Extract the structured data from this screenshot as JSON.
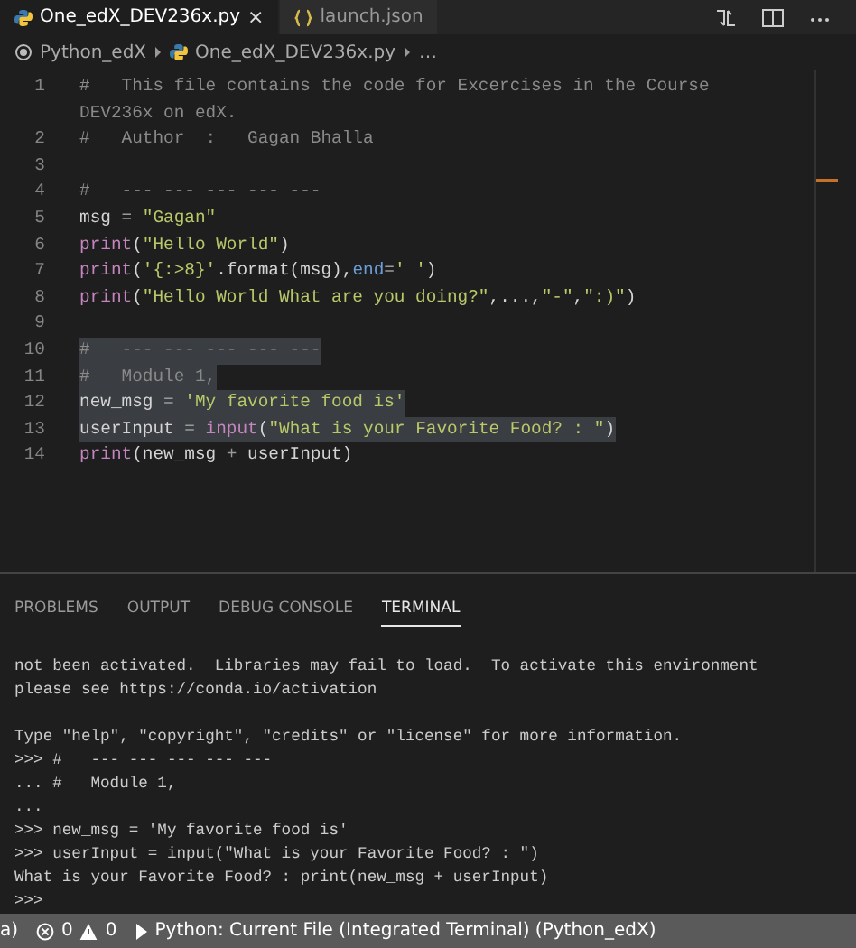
{
  "editor_tabs": [
    {
      "label": "One_edX_DEV236x.py",
      "kind": "python",
      "close": "×",
      "selected": true
    },
    {
      "label": "launch.json",
      "kind": "json",
      "selected": false
    }
  ],
  "breadcrumb": [
    "Python_edX",
    "One_edX_DEV236x.py",
    "…"
  ],
  "code_lines": [
    {
      "number": "1",
      "selected": false,
      "tokens": [
        {
          "kind": "comment",
          "text": "#   This file contains the code for Excercises in the Course DEV236x on edX."
        }
      ]
    },
    {
      "number": "2",
      "selected": false,
      "tokens": [
        {
          "kind": "comment",
          "text": "#   Author  :   Gagan Bhalla"
        }
      ]
    },
    {
      "number": "3",
      "selected": false
    },
    {
      "number": "4",
      "selected": false,
      "tokens": [
        {
          "kind": "comment",
          "text": "#   --- --- --- --- ---"
        }
      ]
    },
    {
      "number": "5",
      "selected": false,
      "tokens": [
        {
          "kind": "plain",
          "text": "msg "
        },
        {
          "kind": "op",
          "text": "="
        },
        {
          "kind": "string",
          "text": " \"Gagan\""
        }
      ]
    },
    {
      "number": "6",
      "selected": false,
      "tokens": [
        {
          "kind": "func",
          "text": "print"
        },
        {
          "kind": "plain",
          "text": "("
        },
        {
          "kind": "string",
          "text": "\"Hello World\""
        },
        {
          "kind": "plain",
          "text": ")"
        }
      ]
    },
    {
      "number": "7",
      "selected": false,
      "tokens": [
        {
          "kind": "func",
          "text": "print"
        },
        {
          "kind": "plain",
          "text": "("
        },
        {
          "kind": "string",
          "text": "'{:>8}'"
        },
        {
          "kind": "plain",
          "text": ".format(msg),"
        },
        {
          "kind": "param",
          "text": "end"
        },
        {
          "kind": "op",
          "text": "="
        },
        {
          "kind": "string",
          "text": "' '"
        },
        {
          "kind": "plain",
          "text": ")"
        }
      ]
    },
    {
      "number": "8",
      "selected": false,
      "tokens": [
        {
          "kind": "func",
          "text": "print"
        },
        {
          "kind": "plain",
          "text": "("
        },
        {
          "kind": "string",
          "text": "\"Hello World What are you doing?\""
        },
        {
          "kind": "plain",
          "text": ",...,"
        },
        {
          "kind": "string",
          "text": "\"-\""
        },
        {
          "kind": "plain",
          "text": ","
        },
        {
          "kind": "string",
          "text": "\":)\""
        },
        {
          "kind": "plain",
          "text": ")"
        }
      ]
    },
    {
      "number": "9",
      "selected": false
    },
    {
      "number": "10",
      "selected": true,
      "tokens": [
        {
          "kind": "comment",
          "text": "#   --- --- --- --- ---"
        }
      ]
    },
    {
      "number": "11",
      "selected": true,
      "tokens": [
        {
          "kind": "comment",
          "text": "#   Module 1,"
        }
      ]
    },
    {
      "number": "12",
      "selected": true,
      "tokens": [
        {
          "kind": "plain",
          "text": "new_msg "
        },
        {
          "kind": "op",
          "text": "="
        },
        {
          "kind": "string",
          "text": " 'My favorite food is'"
        }
      ]
    },
    {
      "number": "13",
      "selected": true,
      "tokens": [
        {
          "kind": "plain",
          "text": "userInput "
        },
        {
          "kind": "op",
          "text": "="
        },
        {
          "kind": "func",
          "text": " input"
        },
        {
          "kind": "plain",
          "text": "("
        },
        {
          "kind": "string",
          "text": "\"What is your Favorite Food? : \""
        },
        {
          "kind": "plain",
          "text": ")"
        }
      ]
    },
    {
      "number": "14",
      "selected": false,
      "tokens": [
        {
          "kind": "func",
          "text": "print"
        },
        {
          "kind": "plain",
          "text": "(new_msg "
        },
        {
          "kind": "op",
          "text": "+"
        },
        {
          "kind": "plain",
          "text": " userInput)"
        }
      ]
    }
  ],
  "panel_tabs": [
    {
      "label": "PROBLEMS",
      "selected": false
    },
    {
      "label": "OUTPUT",
      "selected": false
    },
    {
      "label": "DEBUG CONSOLE",
      "selected": false
    },
    {
      "label": "TERMINAL",
      "selected": true
    }
  ],
  "terminal_lines": [
    {
      "kind": "text",
      "text": "not been activated.  Libraries may fail to load.  To activate this environment"
    },
    {
      "kind": "text",
      "text": "please see https://conda.io/activation"
    },
    {
      "kind": "blank"
    },
    {
      "kind": "text",
      "text": "Type \"help\", \"copyright\", \"credits\" or \"license\" for more information."
    },
    {
      "kind": "text",
      "text": ">>> #   --- --- --- --- ---"
    },
    {
      "kind": "text",
      "text": "... #   Module 1,"
    },
    {
      "kind": "text",
      "text": "..."
    },
    {
      "kind": "text",
      "text": ">>> new_msg = 'My favorite food is'"
    },
    {
      "kind": "text",
      "text": ">>> userInput = input(\"What is your Favorite Food? : \")"
    },
    {
      "kind": "text",
      "text": "What is your Favorite Food? : print(new_msg + userInput)"
    },
    {
      "kind": "text",
      "text": ">>>"
    }
  ],
  "status_bar": {
    "left_text": "a)",
    "errors": "0",
    "warnings": "0",
    "run_config": "Python: Current File (Integrated Terminal) (Python_edX)"
  }
}
